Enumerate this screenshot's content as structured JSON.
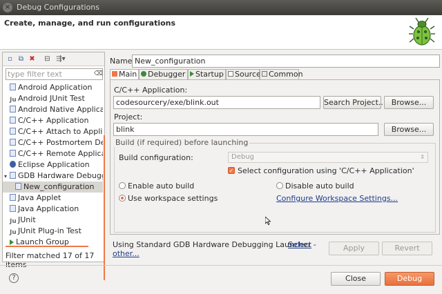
{
  "window": {
    "title": "Debug Configurations"
  },
  "banner": {
    "title": "Create, manage, and run configurations"
  },
  "left": {
    "filter_placeholder": "type filter text",
    "items": [
      {
        "label": "Android Application"
      },
      {
        "label": "Android JUnit Test"
      },
      {
        "label": "Android Native Applicatio"
      },
      {
        "label": "C/C++ Application"
      },
      {
        "label": "C/C++ Attach to Applicati"
      },
      {
        "label": "C/C++ Postmortem Debu"
      },
      {
        "label": "C/C++ Remote Applicatio"
      },
      {
        "label": "Eclipse Application"
      },
      {
        "label": "GDB Hardware Debuggin"
      },
      {
        "label": "New_configuration"
      },
      {
        "label": "Java Applet"
      },
      {
        "label": "Java Application"
      },
      {
        "label": "JUnit"
      },
      {
        "label": "JUnit Plug-in Test"
      },
      {
        "label": "Launch Group"
      }
    ],
    "status": "Filter matched 17 of 17 items"
  },
  "right": {
    "name_label": "Name:",
    "name_value": "New_configuration",
    "tabs": [
      {
        "label": "Main"
      },
      {
        "label": "Debugger"
      },
      {
        "label": "Startup"
      },
      {
        "label": "Source"
      },
      {
        "label": "Common"
      }
    ],
    "app_label": "C/C++ Application:",
    "app_value": "codesourcery/exe/blink.out",
    "search_project": "Search Project...",
    "browse": "Browse...",
    "project_label": "Project:",
    "project_value": "blink",
    "build_group": "Build (if required) before launching",
    "build_config_label": "Build configuration:",
    "build_config_value": "Debug",
    "select_config_label": "Select configuration using 'C/C++ Application'",
    "enable_auto": "Enable auto build",
    "disable_auto": "Disable auto build",
    "use_workspace": "Use workspace settings",
    "configure_link": "Configure Workspace Settings...",
    "launcher_text": "Using Standard GDB Hardware Debugging Launcher - ",
    "select_other": "Select other...",
    "apply": "Apply",
    "revert": "Revert"
  },
  "footer": {
    "close": "Close",
    "debug": "Debug"
  },
  "colors": {
    "accent": "#f07746",
    "link": "#1d3c8a"
  }
}
